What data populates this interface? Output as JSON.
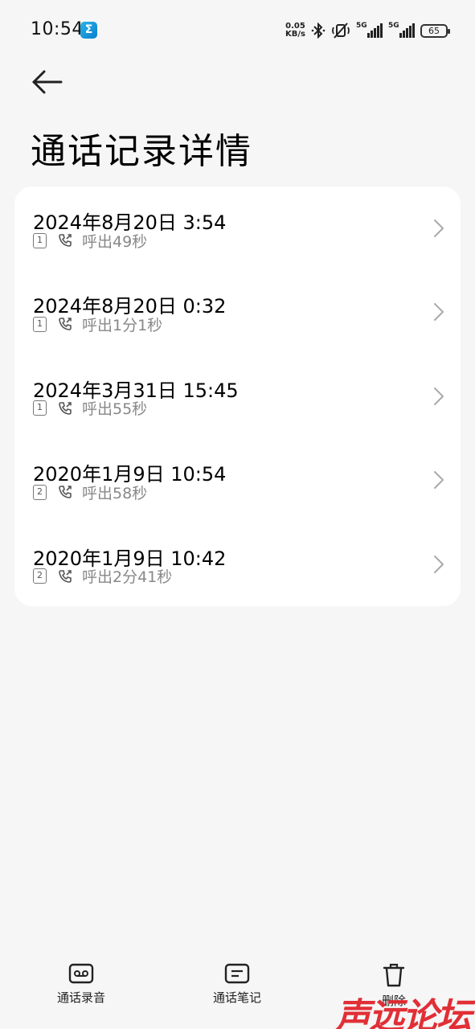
{
  "status_bar": {
    "time": "10:54",
    "app_badge": "Σ",
    "net_speed_value": "0.05",
    "net_speed_unit": "KB/s",
    "sim1_network": "5G",
    "sim2_network": "5G",
    "battery": "65",
    "icons": [
      "bluetooth-icon",
      "mute-icon",
      "signal-icon",
      "battery-icon"
    ]
  },
  "header": {
    "title": "通话记录详情"
  },
  "calls": [
    {
      "date": "2024年8月20日 3:54",
      "sim": "1",
      "type": "呼出49秒"
    },
    {
      "date": "2024年8月20日 0:32",
      "sim": "1",
      "type": "呼出1分1秒"
    },
    {
      "date": "2024年3月31日 15:45",
      "sim": "1",
      "type": "呼出55秒"
    },
    {
      "date": "2020年1月9日 10:54",
      "sim": "2",
      "type": "呼出58秒"
    },
    {
      "date": "2020年1月9日 10:42",
      "sim": "2",
      "type": "呼出2分41秒"
    }
  ],
  "bottom_bar": {
    "recording_label": "通话录音",
    "notes_label": "通话笔记",
    "delete_label": "删除"
  },
  "watermark": "声远论坛",
  "colors": {
    "background": "#f6f6f6",
    "card": "#ffffff",
    "secondary_text": "#888888",
    "watermark": "#e0252c"
  }
}
